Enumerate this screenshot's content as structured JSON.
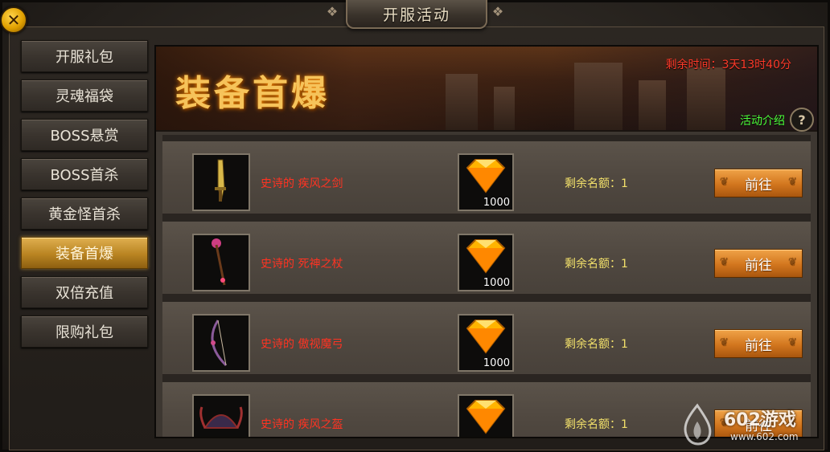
{
  "window": {
    "title": "开服活动"
  },
  "close_button": {
    "label": "✕"
  },
  "sidebar": {
    "items": [
      {
        "label": "开服礼包"
      },
      {
        "label": "灵魂福袋"
      },
      {
        "label": "BOSS悬赏"
      },
      {
        "label": "BOSS首杀"
      },
      {
        "label": "黄金怪首杀"
      },
      {
        "label": "装备首爆",
        "active": true
      },
      {
        "label": "双倍充值"
      },
      {
        "label": "限购礼包"
      }
    ]
  },
  "banner": {
    "title": "装备首爆",
    "remaining_time": "剩余时间：3天13时40分",
    "activity_intro": "活动介绍",
    "help_label": "?"
  },
  "rewards": [
    {
      "item_name": "史诗的 疾风之剑",
      "gem_count": "1000",
      "quota": "剩余名额：1",
      "button": "前往"
    },
    {
      "item_name": "史诗的 死神之杖",
      "gem_count": "1000",
      "quota": "剩余名额：1",
      "button": "前往"
    },
    {
      "item_name": "史诗的 傲视魔弓",
      "gem_count": "1000",
      "quota": "剩余名额：1",
      "button": "前往"
    },
    {
      "item_name": "史诗的 疾风之盔",
      "gem_count": "",
      "quota": "剩余名额：1",
      "button": "前往"
    }
  ],
  "watermark": {
    "brand": "602游戏",
    "url": "www.602.com"
  },
  "colors": {
    "accent_gold": "#e0b050",
    "item_name_red": "#ff3322",
    "quota_yellow": "#f2e06a",
    "intro_green": "#4cff3a",
    "timer_red": "#ff3a2a",
    "button_orange": "#d2761e"
  }
}
